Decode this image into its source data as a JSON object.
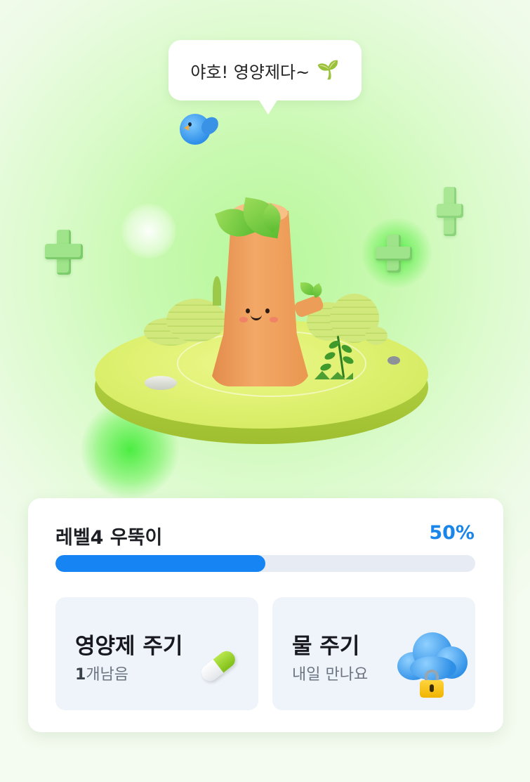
{
  "speech_bubble": {
    "text": "야호! 영양제다~",
    "emoji": "🌱"
  },
  "level": {
    "title": "레벨4 우뚝이",
    "percent_label": "50%",
    "progress": 0.5
  },
  "actions": [
    {
      "title": "영양제 주기",
      "count": "1",
      "subtitle_suffix": "개남음",
      "icon": "pill-icon"
    },
    {
      "title": "물 주기",
      "subtitle": "내일 만나요",
      "icon": "cloud-lock-icon"
    }
  ],
  "colors": {
    "accent": "#1685f3",
    "percent_text": "#1a86ea",
    "background_green": "#b6f79a"
  }
}
